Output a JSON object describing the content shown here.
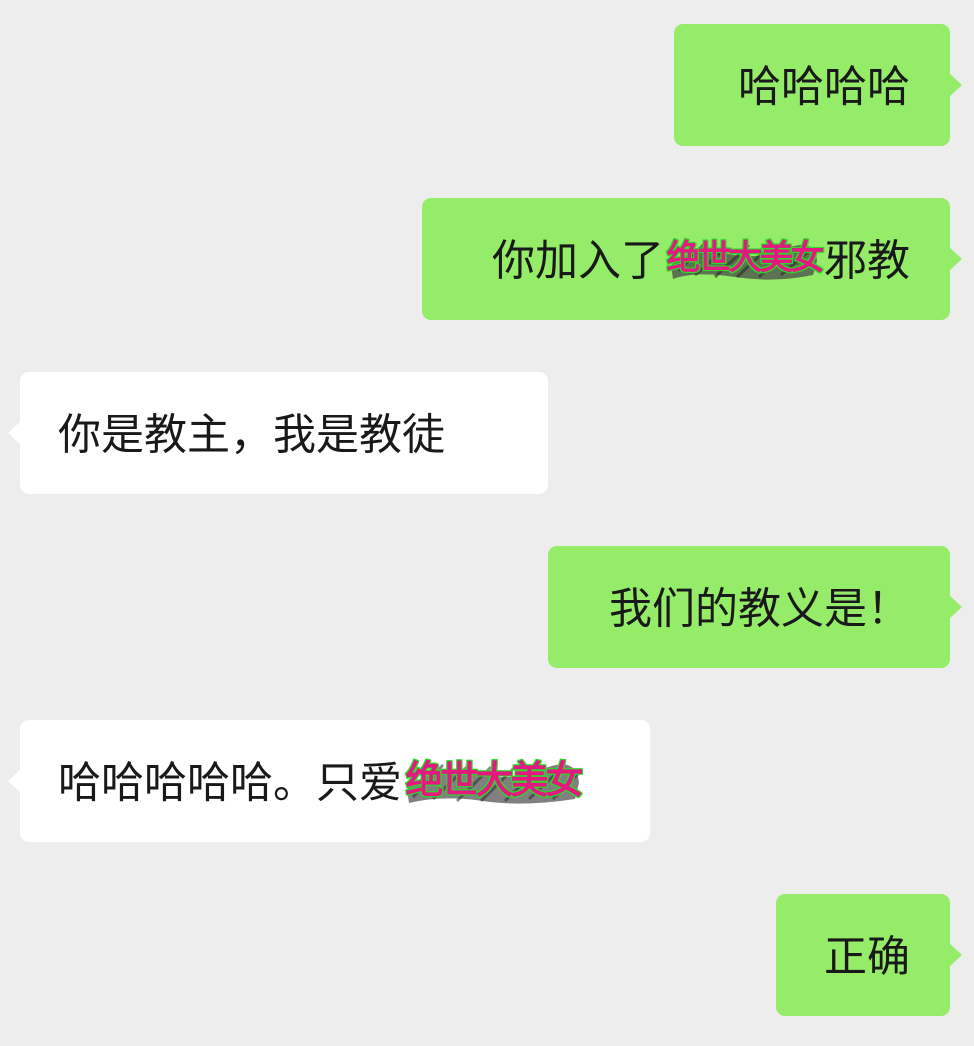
{
  "chat": {
    "messages": [
      {
        "side": "right",
        "text": "哈哈哈哈"
      },
      {
        "side": "right",
        "text_before": "你加入了",
        "sticker_text": "绝世大美女",
        "text_after": "邪教"
      },
      {
        "side": "left",
        "text": "你是教主，我是教徒"
      },
      {
        "side": "right",
        "text": "我们的教义是！"
      },
      {
        "side": "left",
        "text_before": "哈哈哈哈哈。只爱",
        "sticker_text": "绝世大美女"
      },
      {
        "side": "right",
        "text": "正确"
      }
    ]
  },
  "colors": {
    "background": "#EDEDED",
    "outgoing_bubble": "#95EC69",
    "incoming_bubble": "#FFFFFF",
    "text": "#191919",
    "sticker_fill": "#E3197F",
    "sticker_outline": "#3BE13A"
  },
  "icons": {
    "sticker": "绝世大美女-sticker-icon"
  }
}
